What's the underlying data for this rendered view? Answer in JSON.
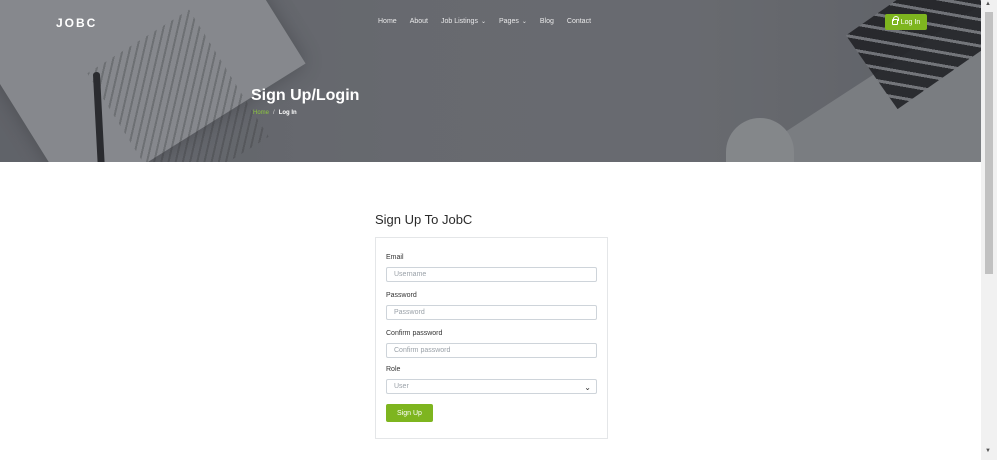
{
  "header": {
    "logo": "JOBC",
    "nav": [
      {
        "label": "Home",
        "dropdown": false
      },
      {
        "label": "About",
        "dropdown": false
      },
      {
        "label": "Job Listings",
        "dropdown": true
      },
      {
        "label": "Pages",
        "dropdown": true
      },
      {
        "label": "Blog",
        "dropdown": false
      },
      {
        "label": "Contact",
        "dropdown": false
      }
    ],
    "login_button": "Log In",
    "accent": "#7eb51f"
  },
  "hero": {
    "title": "Sign Up/Login",
    "breadcrumb": {
      "home": "Home",
      "separator": "/",
      "current": "Log In"
    }
  },
  "form": {
    "heading": "Sign Up To JobC",
    "email_label": "Email",
    "email_placeholder": "Username",
    "password_label": "Password",
    "password_placeholder": "Password",
    "confirm_label": "Confirm password",
    "confirm_placeholder": "Confirm password",
    "role_label": "Role",
    "role_selected": "User",
    "submit": "Sign Up"
  }
}
